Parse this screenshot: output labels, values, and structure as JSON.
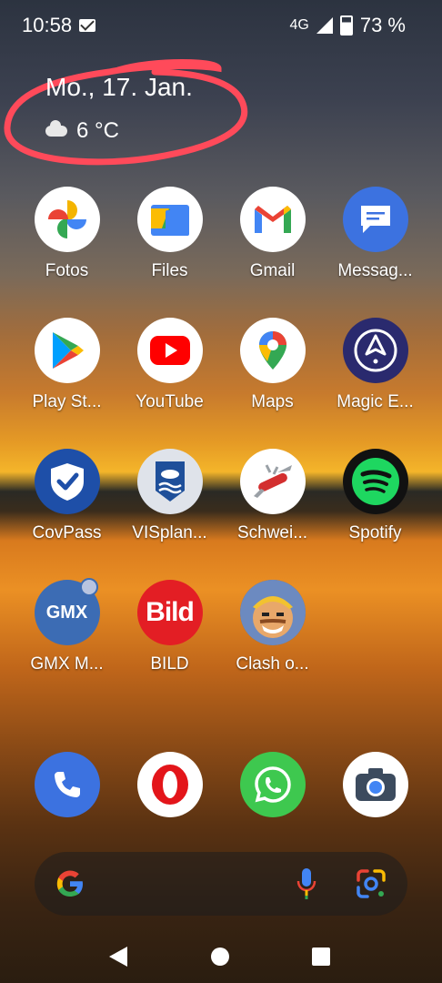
{
  "statusbar": {
    "time": "10:58",
    "network": "4G",
    "battery": "73 %"
  },
  "widget": {
    "date": "Mo., 17. Jan.",
    "temperature": "6 °C"
  },
  "apps": {
    "fotos": "Fotos",
    "files": "Files",
    "gmail": "Gmail",
    "messages": "Messag...",
    "playstore": "Play St...",
    "youtube": "YouTube",
    "maps": "Maps",
    "magic": "Magic E...",
    "covpass": "CovPass",
    "visplan": "VISplan...",
    "schwei": "Schwei...",
    "spotify": "Spotify",
    "gmx": "GMX M...",
    "bild": "BILD",
    "clash": "Clash o..."
  },
  "icon_text": {
    "gmx": "GMX",
    "bild": "Bild"
  },
  "colors": {
    "accent_red": "#ff4a5a"
  }
}
